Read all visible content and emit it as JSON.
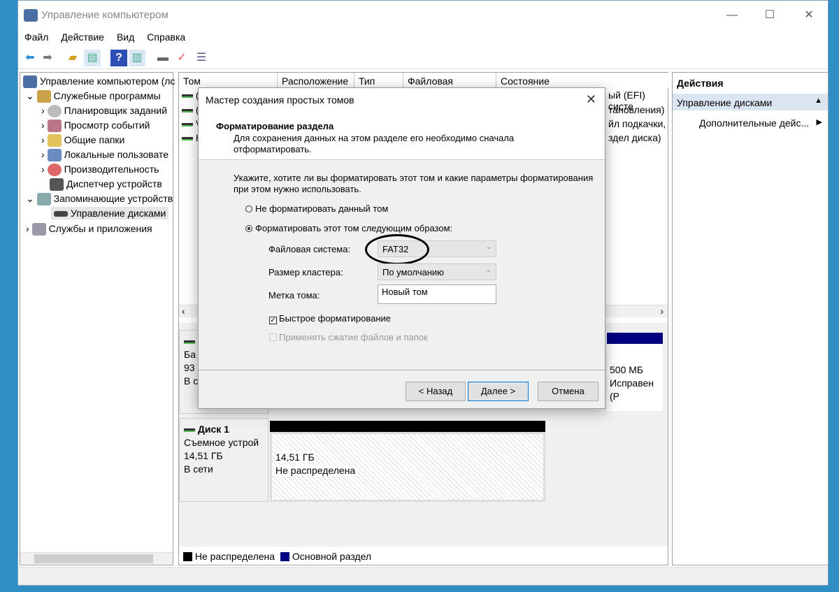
{
  "window": {
    "title": "Управление компьютером",
    "minimize": "—",
    "maximize": "☐",
    "close": "✕"
  },
  "menu": [
    "Файл",
    "Действие",
    "Вид",
    "Справка"
  ],
  "toolbar": [
    "back-icon",
    "forward-icon",
    "up-folder-icon",
    "show-hide-tree-icon",
    "help-icon",
    "show-hide-action-icon",
    "connect-icon",
    "check-icon",
    "properties-icon"
  ],
  "tree": {
    "root": "Управление компьютером (лс",
    "items": [
      {
        "label": "Служебные программы",
        "level": 1,
        "expanded": true
      },
      {
        "label": "Планировщик заданий",
        "level": 2
      },
      {
        "label": "Просмотр событий",
        "level": 2
      },
      {
        "label": "Общие папки",
        "level": 2
      },
      {
        "label": "Локальные пользовате",
        "level": 2
      },
      {
        "label": "Производительность",
        "level": 2
      },
      {
        "label": "Диспетчер устройств",
        "level": 2
      },
      {
        "label": "Запоминающие устройств",
        "level": 1,
        "expanded": true
      },
      {
        "label": "Управление дисками",
        "level": 2,
        "selected": true
      },
      {
        "label": "Службы и приложения",
        "level": 1
      }
    ]
  },
  "volumes": {
    "columns": [
      "Том",
      "Расположение",
      "Тип",
      "Файловая система",
      "Состояние"
    ],
    "rows_prefix": [
      "(",
      "(",
      "V",
      "H"
    ],
    "rows_suffix": [
      "ый (EFI) систе",
      "тановления)",
      "йл подкачки,",
      "здел диска)"
    ]
  },
  "disk0": {
    "l1": "Ба",
    "l2": "93",
    "l3": "В с",
    "size": "500 МБ",
    "status": "Исправен (Р"
  },
  "disk1": {
    "name": "Диск 1",
    "type": "Съемное устрой",
    "size": "14,51 ГБ",
    "status": "В сети",
    "part_size": "14,51 ГБ",
    "part_state": "Не распределена"
  },
  "legend": [
    {
      "label": "Не распределена",
      "color": "#000000"
    },
    {
      "label": "Основной раздел",
      "color": "#000080"
    }
  ],
  "actions": {
    "title": "Действия",
    "section": "Управление дисками",
    "more": "Дополнительные дейс..."
  },
  "dialog": {
    "title": "Мастер создания простых томов",
    "heading": "Форматирование раздела",
    "subheading": "Для сохранения данных на этом разделе его необходимо сначала отформатировать.",
    "prompt": "Укажите, хотите ли вы форматировать этот том и какие параметры форматирования при этом нужно использовать.",
    "opt_no": "Не форматировать данный том",
    "opt_yes": "Форматировать этот том следующим образом:",
    "fs_label": "Файловая система:",
    "fs_value": "FAT32",
    "cluster_label": "Размер кластера:",
    "cluster_value": "По умолчанию",
    "vol_label": "Метка тома:",
    "vol_value": "Новый том",
    "quick": "Быстрое форматирование",
    "quick_checked": true,
    "compress": "Применять сжатие файлов и папок",
    "compress_checked": false,
    "back": "< Назад",
    "next": "Далее >",
    "cancel": "Отмена"
  }
}
